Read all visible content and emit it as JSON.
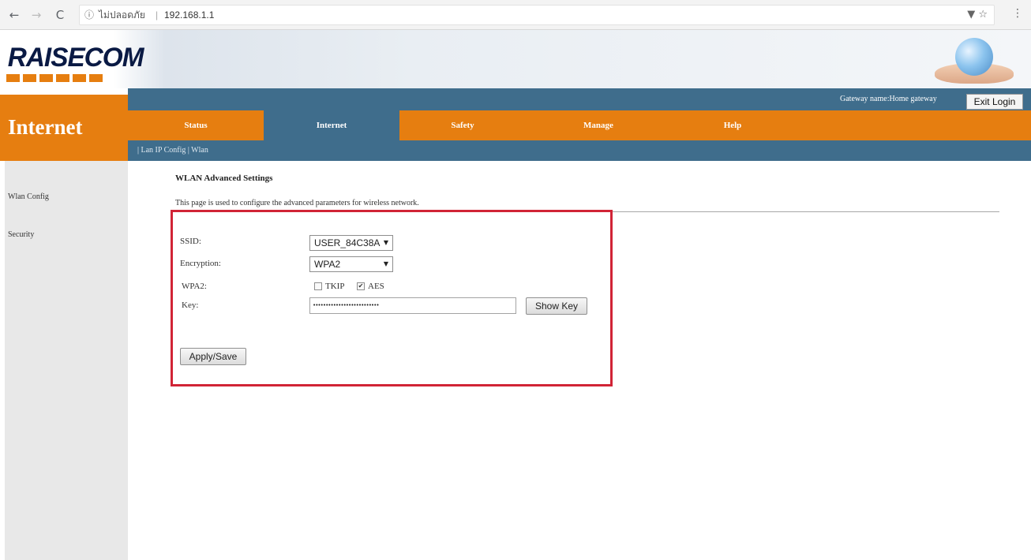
{
  "browser": {
    "back": "←",
    "forward": "→",
    "reload": "C",
    "info_icon": "ⓘ",
    "security_text": "ไม่ปลอดภัย",
    "separator": "|",
    "url": "192.168.1.1",
    "right_icons": "▼ ☆",
    "menu": "⋮"
  },
  "header": {
    "logo": "RAISECOM"
  },
  "top_bar": {
    "gateway_text": "Gateway name:Home gateway",
    "exit_label": "Exit Login"
  },
  "side_title": "Internet",
  "menu": {
    "items": [
      "Status",
      "Internet",
      "Safety",
      "Manage",
      "Help"
    ]
  },
  "subnav": "| Lan IP Config | Wlan",
  "sidebar": {
    "items": [
      "Wlan Config",
      "Security"
    ]
  },
  "content": {
    "title": "WLAN Advanced Settings",
    "description": "This page is used to configure the advanced parameters for wireless network.",
    "ssid_label": "SSID:",
    "ssid_value": "USER_84C38A",
    "encryption_label": "Encryption:",
    "encryption_value": "WPA2",
    "wpa2_label": "WPA2:",
    "tkip_label": "TKIP",
    "tkip_checked": false,
    "aes_label": "AES",
    "aes_checked": true,
    "key_label": "Key:",
    "key_value": "••••••••••••••••••••••••••",
    "show_key_label": "Show Key",
    "apply_label": "Apply/Save"
  },
  "colors": {
    "orange": "#e67e10",
    "blue": "#3f6d8c",
    "highlight_red": "#d12436"
  }
}
